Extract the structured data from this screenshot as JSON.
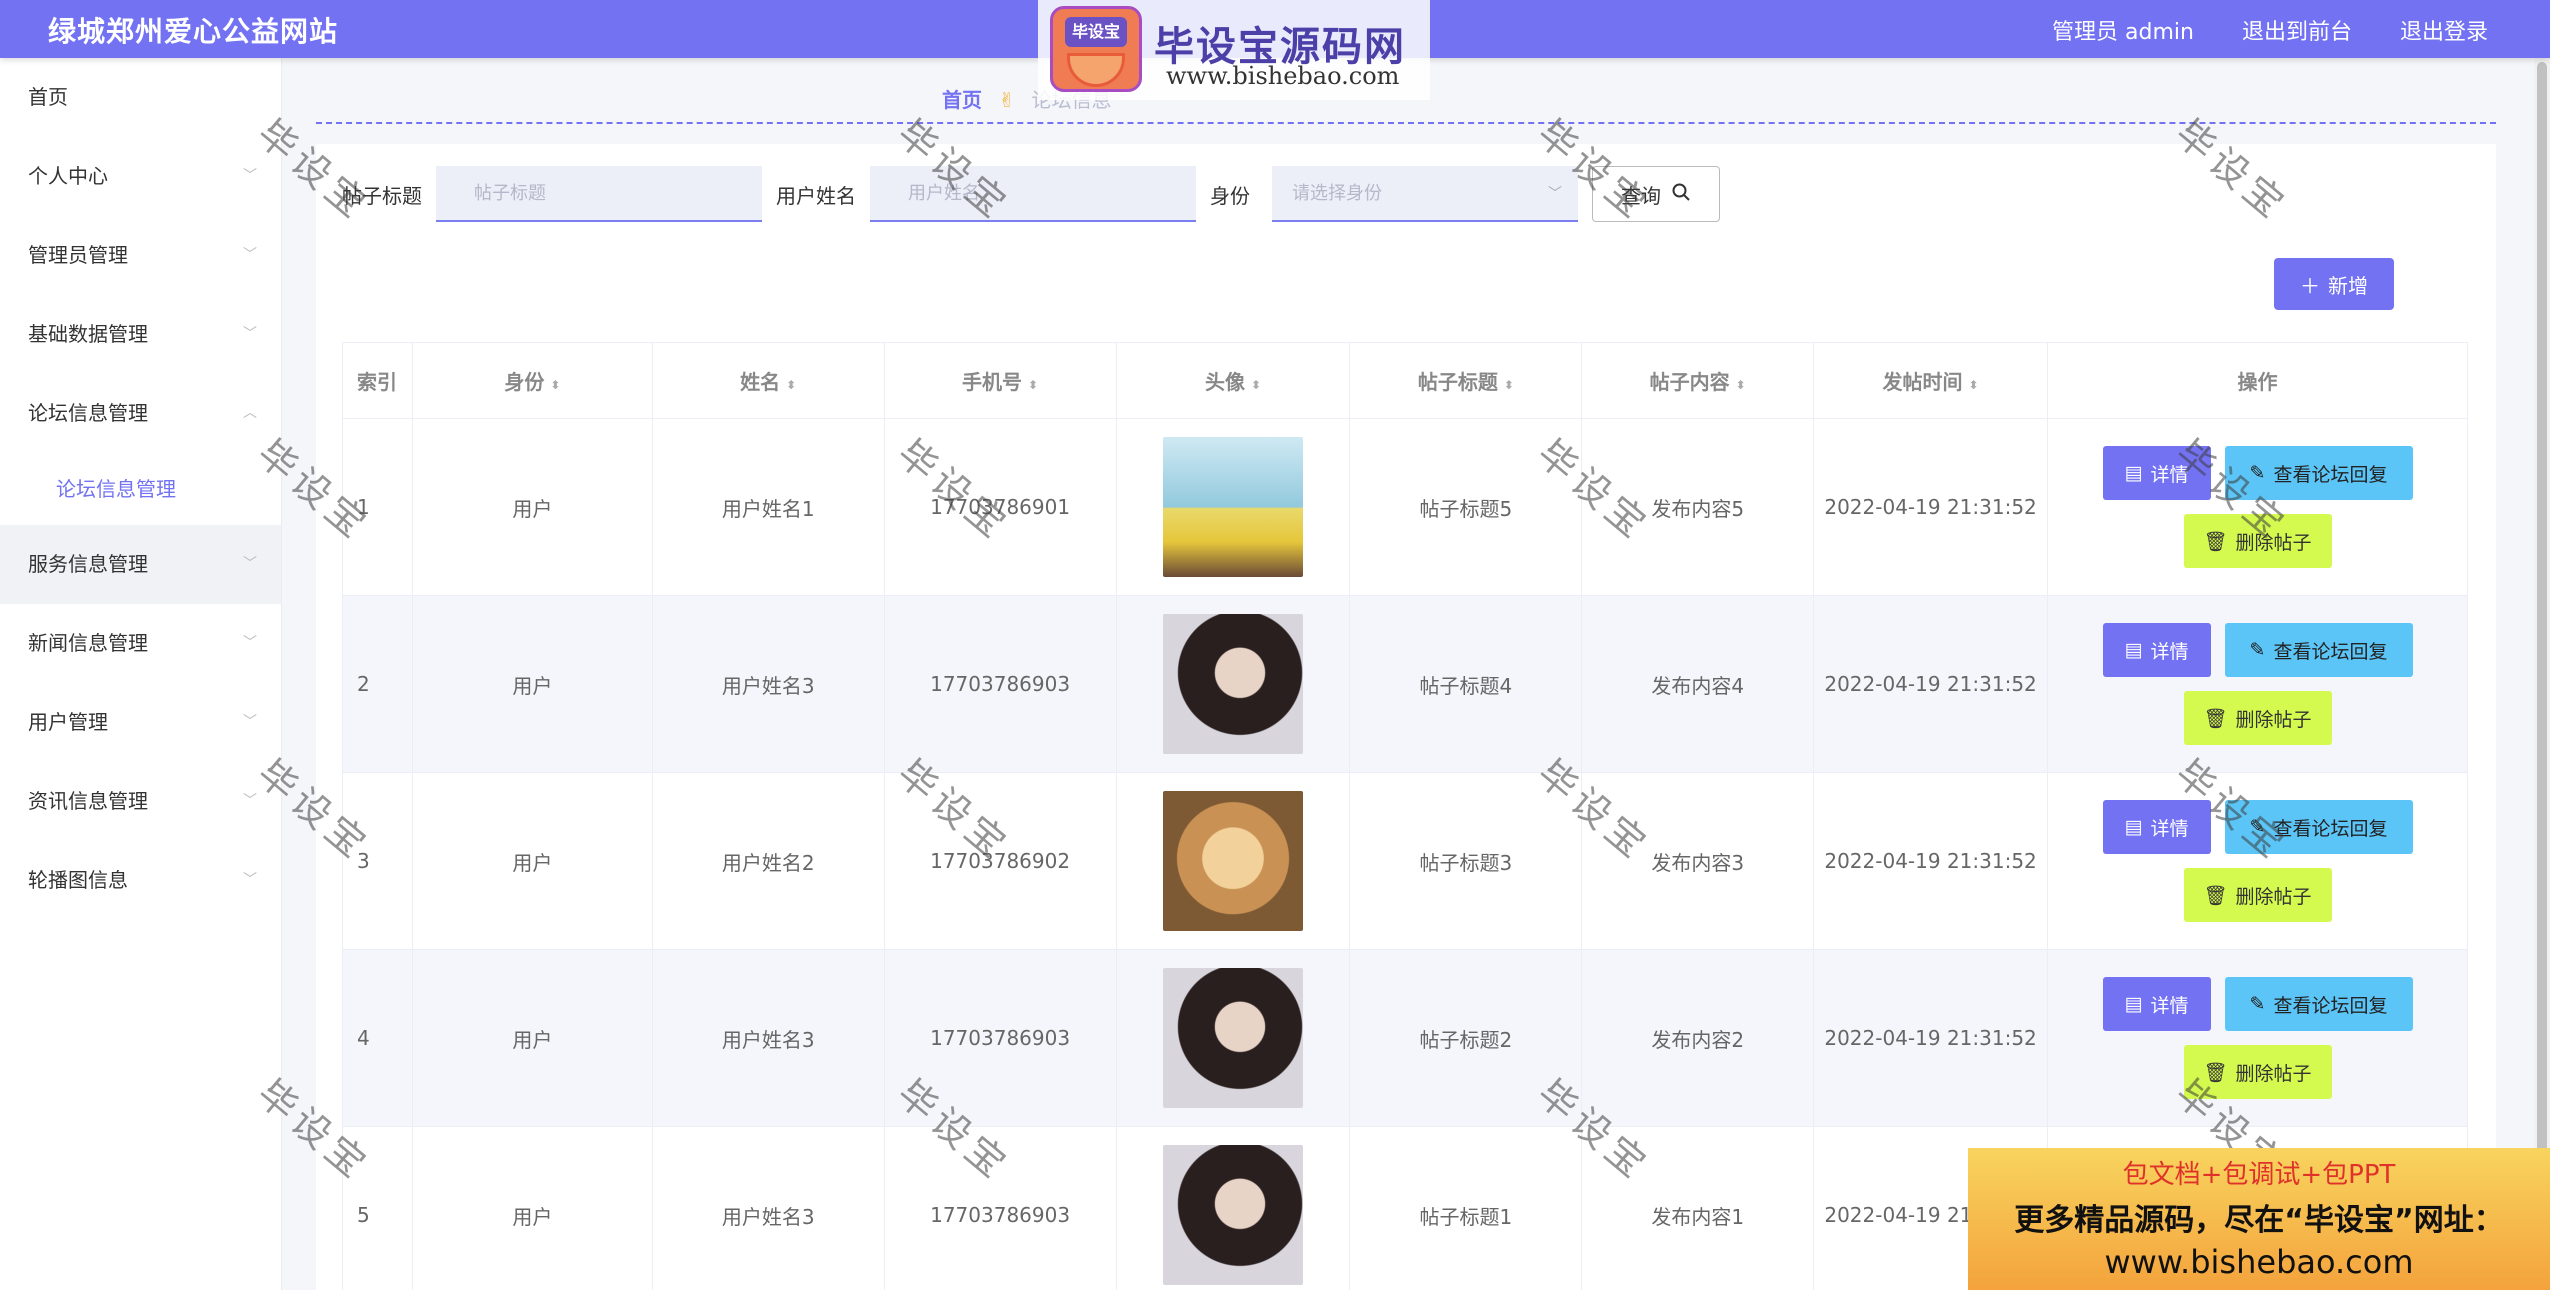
{
  "header": {
    "brand": "绿城郑州爱心公益网站",
    "user": "管理员 admin",
    "exit_front": "退出到前台",
    "logout": "退出登录"
  },
  "watermark_logo": {
    "badge": "毕设宝",
    "title": "毕设宝源码网",
    "url": "www.bishebao.com"
  },
  "sidebar": {
    "items": [
      {
        "label": "首页"
      },
      {
        "label": "个人中心"
      },
      {
        "label": "管理员管理"
      },
      {
        "label": "基础数据管理"
      },
      {
        "label": "论坛信息管理"
      },
      {
        "label": "论坛信息管理"
      },
      {
        "label": "服务信息管理"
      },
      {
        "label": "新闻信息管理"
      },
      {
        "label": "用户管理"
      },
      {
        "label": "资讯信息管理"
      },
      {
        "label": "轮播图信息"
      }
    ]
  },
  "breadcrumb": {
    "home": "首页",
    "sep": "✌",
    "current": "论坛信息"
  },
  "search": {
    "title_label": "帖子标题",
    "title_placeholder": "帖子标题",
    "name_label": "用户姓名",
    "name_placeholder": "用户姓名",
    "role_label": "身份",
    "role_placeholder": "请选择身份",
    "query_label": "查询"
  },
  "add_label": "新增",
  "table": {
    "headers": [
      "索引",
      "身份",
      "姓名",
      "手机号",
      "头像",
      "帖子标题",
      "帖子内容",
      "发帖时间",
      "操作"
    ],
    "rows": [
      {
        "idx": "1",
        "role": "用户",
        "name": "用户姓名1",
        "phone": "17703786901",
        "avatar": "photo-woman-yellow",
        "title": "帖子标题5",
        "content": "发布内容5",
        "time": "2022-04-19 21:31:52"
      },
      {
        "idx": "2",
        "role": "用户",
        "name": "用户姓名3",
        "phone": "17703786903",
        "avatar": "photo-woman-portrait",
        "title": "帖子标题4",
        "content": "发布内容4",
        "time": "2022-04-19 21:31:52"
      },
      {
        "idx": "3",
        "role": "用户",
        "name": "用户姓名2",
        "phone": "17703786902",
        "avatar": "photo-puppy",
        "title": "帖子标题3",
        "content": "发布内容3",
        "time": "2022-04-19 21:31:52"
      },
      {
        "idx": "4",
        "role": "用户",
        "name": "用户姓名3",
        "phone": "17703786903",
        "avatar": "photo-woman-portrait",
        "title": "帖子标题2",
        "content": "发布内容2",
        "time": "2022-04-19 21:31:52"
      },
      {
        "idx": "5",
        "role": "用户",
        "name": "用户姓名3",
        "phone": "17703786903",
        "avatar": "photo-woman-portrait",
        "title": "帖子标题1",
        "content": "发布内容1",
        "time": "2022-04-19 21:31:52"
      }
    ],
    "ops": {
      "detail": "详情",
      "reply": "查看论坛回复",
      "delete": "删除帖子"
    }
  },
  "watermark_text": "毕设宝",
  "ad": {
    "line1": "包文档+包调试+包PPT",
    "line2": "更多精品源码，尽在“毕设宝”网址：",
    "line3": "www.bishebao.com"
  },
  "colors": {
    "accent": "#7372f2",
    "reply": "#5cc5f7",
    "delete": "#d4f94f"
  }
}
